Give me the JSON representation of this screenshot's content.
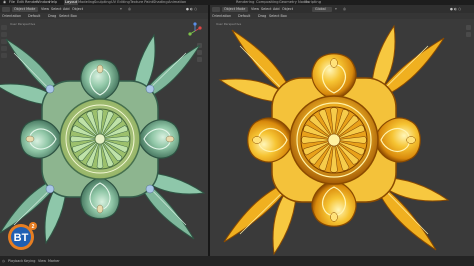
{
  "menubar": {
    "items": [
      "File",
      "Edit",
      "Render",
      "Window",
      "Help"
    ],
    "workspaces": [
      "Layout",
      "Modeling",
      "Sculpting",
      "UV Editing",
      "Texture Paint",
      "Shading",
      "Animation",
      "Rendering",
      "Compositing",
      "Geometry Nodes",
      "Scripting"
    ],
    "active_workspace": "Layout"
  },
  "left_viewport": {
    "header": {
      "editor": "Object Mode",
      "menus": [
        "View",
        "Select",
        "Add",
        "Object"
      ],
      "orientation": "Orientation",
      "default": "Default",
      "drag": "Drag",
      "select_box": "Select Box"
    },
    "overlay": {
      "view": "User Perspective",
      "collection": "(1) Collection | Ornament"
    }
  },
  "right_viewport": {
    "header": {
      "editor": "Object Mode",
      "menus": [
        "View",
        "Select",
        "Add",
        "Object"
      ],
      "orientation": "Orientation",
      "default": "Default",
      "drag": "Drag",
      "select_box": "Select Box",
      "global": "Global"
    },
    "overlay": {
      "view": "User Perspective",
      "collection": "(1) Collection | Ornament"
    }
  },
  "timeline": {
    "items": [
      "Playback",
      "Keying",
      "View",
      "Marker"
    ]
  },
  "logo": {
    "text": "BT",
    "badge": "2"
  },
  "colors": {
    "jade": "#7fb89c",
    "jade_dark": "#355f4c",
    "jade_light": "#c4e6d2",
    "gold": "#f0b020",
    "gold_dark": "#8a4a00",
    "gold_light": "#fff0a0",
    "accent_orange": "#e67e22",
    "logo_blue": "#1f5fb3"
  }
}
